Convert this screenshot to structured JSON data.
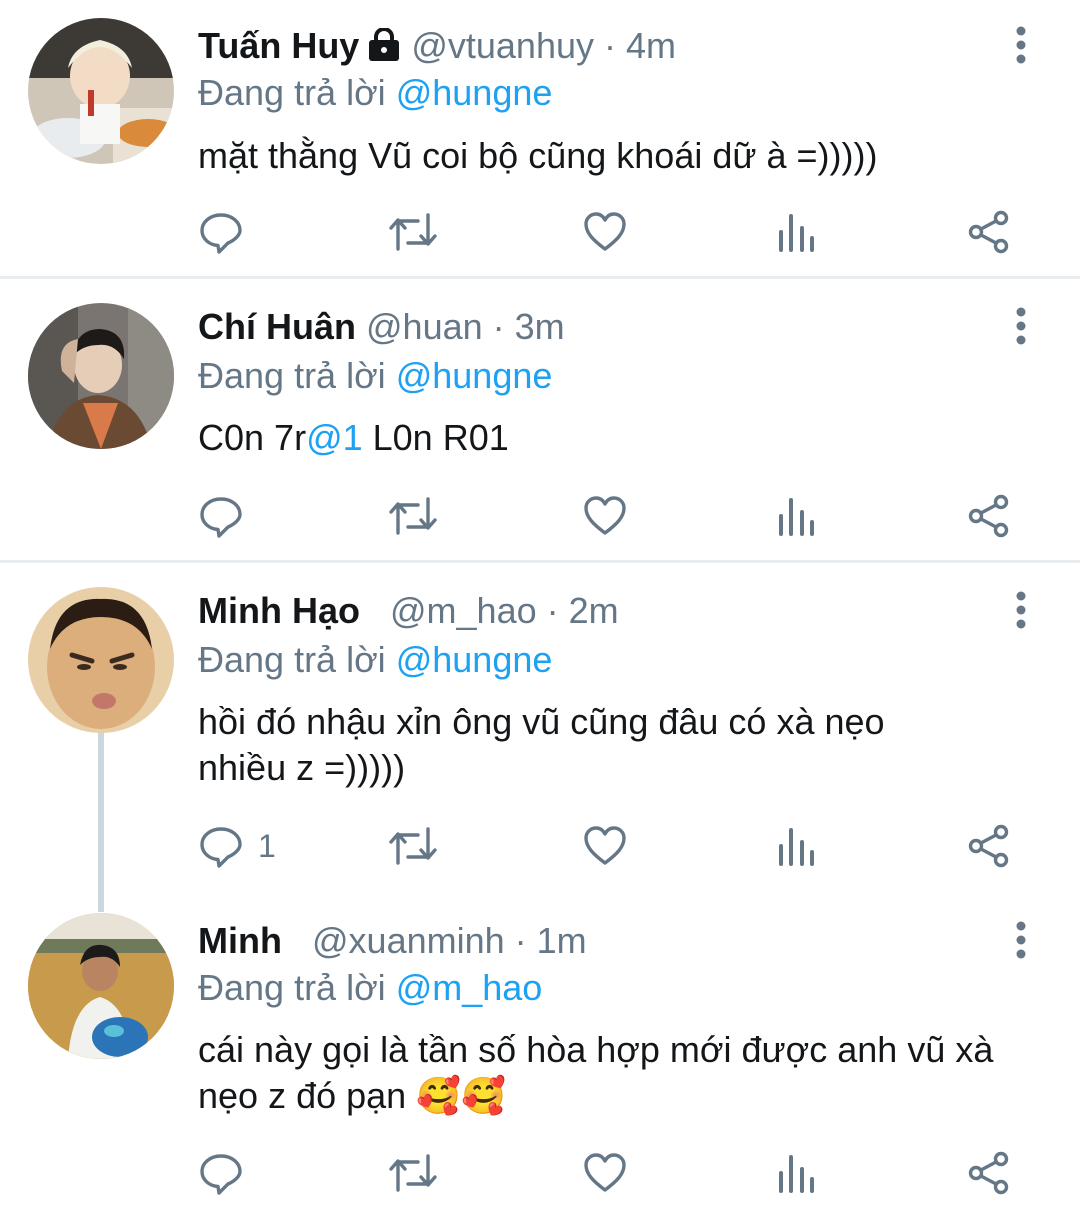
{
  "accent_color": "#1da1f2",
  "tweets": [
    {
      "name": "Tuấn Huy",
      "handle": "@vtuanhuy",
      "time": "· 4m",
      "protected": true,
      "reply_prefix": "Đang trả lời",
      "reply_to": "@hungne",
      "text": "mặt thằng Vũ coi bộ cũng khoái dữ à =)))))",
      "reply_count": ""
    },
    {
      "name": "Chí Huân",
      "handle": "@huan",
      "time": "· 3m",
      "reply_prefix": "Đang trả lời",
      "reply_to": "@hungne",
      "text_a": "C0n 7r",
      "text_mention": "@1",
      "text_b": " L0n R01",
      "reply_count": ""
    },
    {
      "name": "Minh Hạo",
      "handle": "@m_hao",
      "time": "· 2m",
      "reply_prefix": "Đang trả lời",
      "reply_to": "@hungne",
      "text": "hồi đó nhậu xỉn ông vũ cũng đâu có xà nẹo nhiều z =)))))",
      "reply_count": "1"
    },
    {
      "name": "Minh",
      "handle": "@xuanminh",
      "time": "· 1m",
      "reply_prefix": "Đang trả lời",
      "reply_to": "@m_hao",
      "text": "cái này gọi là tần số hòa hợp mới được anh vũ xà nẹo z đó pạn",
      "emoji": "🥰🥰",
      "reply_count": ""
    }
  ],
  "icons": [
    "reply-icon",
    "retweet-icon",
    "like-icon",
    "analytics-icon",
    "share-icon",
    "more-options-icon",
    "lock-icon"
  ]
}
